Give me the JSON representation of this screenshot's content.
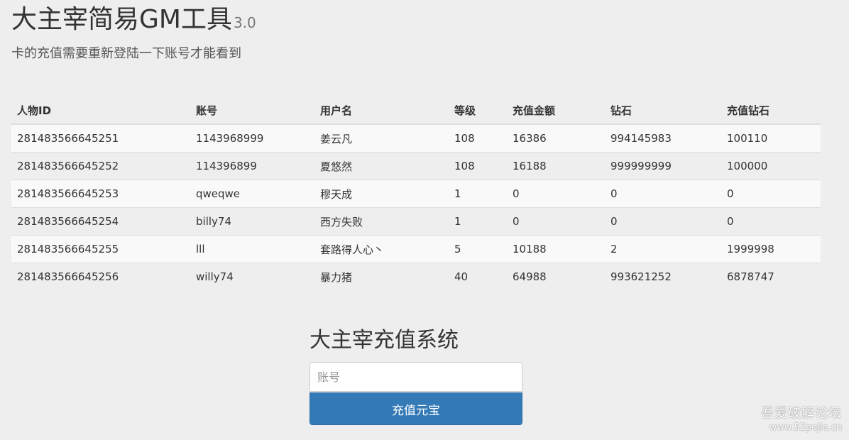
{
  "header": {
    "title": "大主宰简易GM工具",
    "version": "3.0",
    "subtitle": "卡的充值需要重新登陆一下账号才能看到"
  },
  "table": {
    "columns": [
      "人物ID",
      "账号",
      "用户名",
      "等级",
      "充值金额",
      "钻石",
      "充值钻石"
    ],
    "rows": [
      [
        "281483566645251",
        "1143968999",
        "姜云凡",
        "108",
        "16386",
        "994145983",
        "100110"
      ],
      [
        "281483566645252",
        "114396899",
        "夏悠然",
        "108",
        "16188",
        "999999999",
        "100000"
      ],
      [
        "281483566645253",
        "qweqwe",
        "穆天成",
        "1",
        "0",
        "0",
        "0"
      ],
      [
        "281483566645254",
        "billy74",
        "西方失败",
        "1",
        "0",
        "0",
        "0"
      ],
      [
        "281483566645255",
        "lll",
        "套路得人心丶",
        "5",
        "10188",
        "2",
        "1999998"
      ],
      [
        "281483566645256",
        "willy74",
        "暴力猪",
        "40",
        "64988",
        "993621252",
        "6878747"
      ]
    ]
  },
  "recharge": {
    "title": "大主宰充值系统",
    "account_placeholder": "账号",
    "account_value": "",
    "submit_label": "充值元宝"
  },
  "watermark": {
    "title": "吾爱破解论坛",
    "url": "www.52pojie.cn"
  },
  "colors": {
    "background": "#eeeeee",
    "primary_button": "#337ab7",
    "striped_row": "#f9f9f9"
  }
}
